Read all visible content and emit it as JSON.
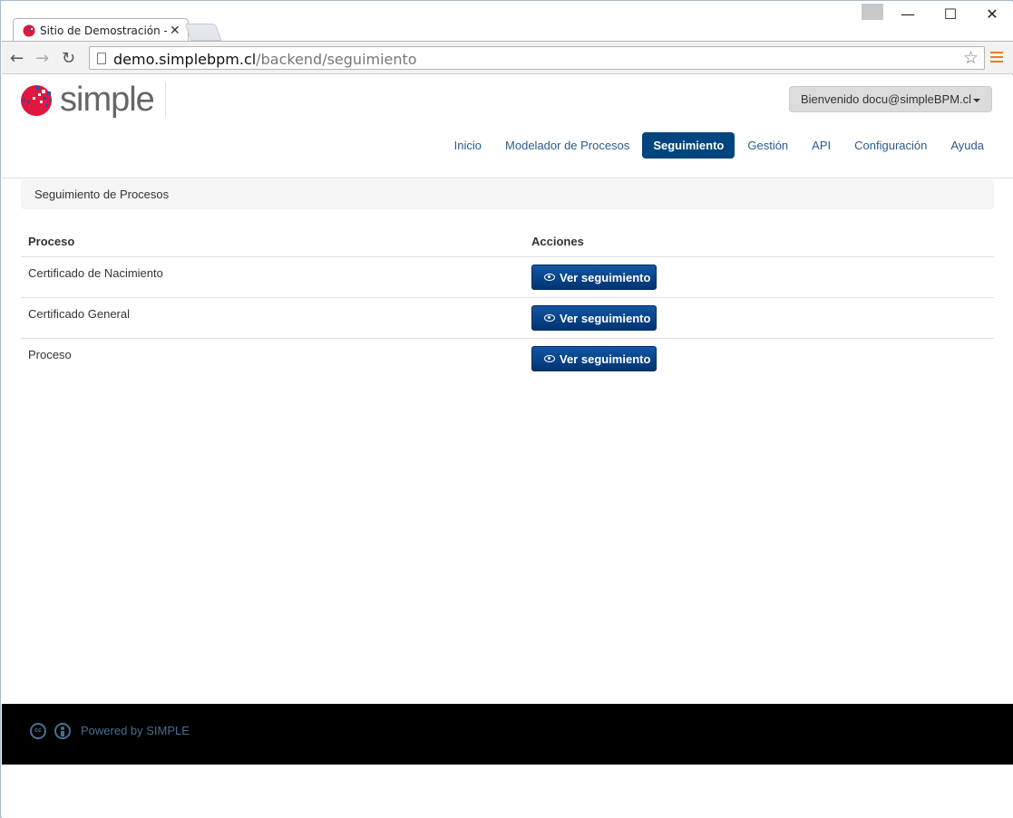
{
  "browser": {
    "tab_title": "Sitio de Demostración - Li",
    "url_host": "demo.simplebpm.cl",
    "url_path": "/backend/seguimiento",
    "win_min": "—",
    "win_max": "☐",
    "win_close": "✕"
  },
  "header": {
    "logo_text": "simple",
    "welcome": "Bienvenido docu@simpleBPM.cl"
  },
  "nav": {
    "items": [
      "Inicio",
      "Modelador de Procesos",
      "Seguimiento",
      "Gestión",
      "API",
      "Configuración",
      "Ayuda"
    ],
    "active": "Seguimiento"
  },
  "breadcrumb": "Seguimiento de Procesos",
  "table": {
    "headers": [
      "Proceso",
      "Acciones"
    ],
    "rows": [
      {
        "name": "Certificado de Nacimiento",
        "action": "Ver seguimiento"
      },
      {
        "name": "Certificado General",
        "action": "Ver seguimiento"
      },
      {
        "name": "Proceso",
        "action": "Ver seguimiento"
      }
    ]
  },
  "footer": {
    "powered": "Powered by SIMPLE",
    "cc_text": "cc"
  },
  "colors": {
    "accent": "#00457d",
    "link": "#2a5b8c",
    "footer_bg": "#000000",
    "footer_link": "#4a6e93"
  }
}
